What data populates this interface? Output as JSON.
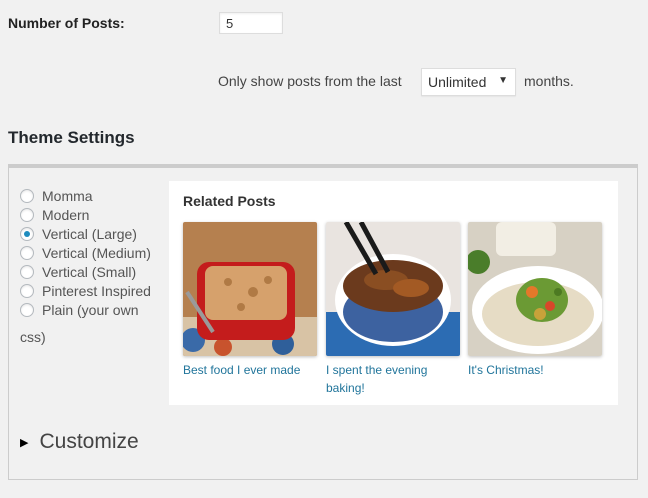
{
  "settings": {
    "number_of_posts_label": "Number of Posts:",
    "number_of_posts_value": "5",
    "months_prefix": "Only show posts from the last",
    "months_selected": "Unlimited",
    "months_suffix": "months."
  },
  "theme_settings": {
    "heading": "Theme Settings",
    "themes": [
      {
        "label": "Momma",
        "checked": false
      },
      {
        "label": "Modern",
        "checked": false
      },
      {
        "label": "Vertical (Large)",
        "checked": true
      },
      {
        "label": "Vertical (Medium)",
        "checked": false
      },
      {
        "label": "Vertical (Small)",
        "checked": false
      },
      {
        "label": "Pinterest Inspired",
        "checked": false
      },
      {
        "label": "Plain (your own",
        "checked": false
      }
    ],
    "plain_continuation": "css)",
    "preview": {
      "title": "Related Posts",
      "posts": [
        {
          "caption_line1": "Best food I ever made",
          "caption_line2": ""
        },
        {
          "caption_line1": "I spent the evening",
          "caption_line2": "baking!"
        },
        {
          "caption_line1": "It's Christmas!",
          "caption_line2": ""
        }
      ]
    },
    "customize_label": "Customize"
  },
  "colors": {
    "accent": "#1e8cbe",
    "link": "#21759b",
    "background": "#f1f1f1"
  },
  "icons": [
    "triangle-right-icon",
    "chevron-down-icon",
    "radio-icon"
  ]
}
